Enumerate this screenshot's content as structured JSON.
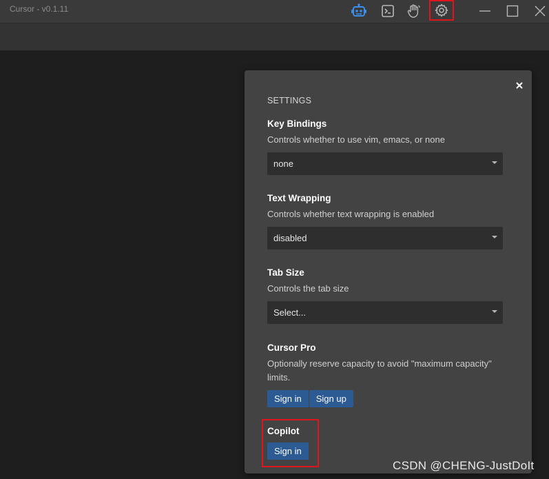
{
  "window": {
    "title": "Cursor - v0.1.11"
  },
  "titlebar_icons": [
    "robot-icon",
    "terminal-icon",
    "hand-icon",
    "gear-icon"
  ],
  "window_controls": [
    "minimize-icon",
    "maximize-icon",
    "close-icon"
  ],
  "colors": {
    "accent_blue": "#2c5a93",
    "highlight_red": "#e0141b",
    "panel_bg": "#434343",
    "editor_bg": "#1e1e1e"
  },
  "settings": {
    "heading": "SETTINGS",
    "key_bindings": {
      "title": "Key Bindings",
      "description": "Controls whether to use vim, emacs, or none",
      "value": "none"
    },
    "text_wrapping": {
      "title": "Text Wrapping",
      "description": "Controls whether text wrapping is enabled",
      "value": "disabled"
    },
    "tab_size": {
      "title": "Tab Size",
      "description": "Controls the tab size",
      "value": "Select..."
    },
    "cursor_pro": {
      "title": "Cursor Pro",
      "description": "Optionally reserve capacity to avoid \"maximum capacity\" limits.",
      "sign_in_label": "Sign in",
      "sign_up_label": "Sign up"
    },
    "copilot": {
      "title": "Copilot",
      "sign_in_label": "Sign in"
    }
  },
  "watermark": "CSDN @CHENG-JustDoIt"
}
